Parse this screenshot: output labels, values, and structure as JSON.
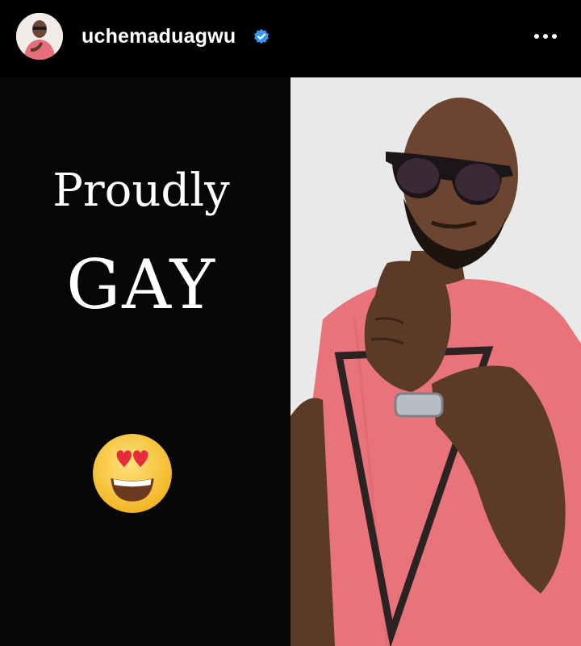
{
  "header": {
    "username": "uchemaduagwu",
    "verified_icon": "verified-badge-icon",
    "more_icon": "more-options-icon",
    "avatar_icon": "profile-avatar"
  },
  "post": {
    "text_line1": "Proudly",
    "text_line2": "GAY",
    "emoji": "heart-eyes-emoji",
    "photo": "man-in-pink-tshirt-sunglasses"
  },
  "colors": {
    "background": "#000000",
    "verified": "#3797f0",
    "shirt": "#e8737a",
    "photo_bg": "#e9e9ea"
  }
}
